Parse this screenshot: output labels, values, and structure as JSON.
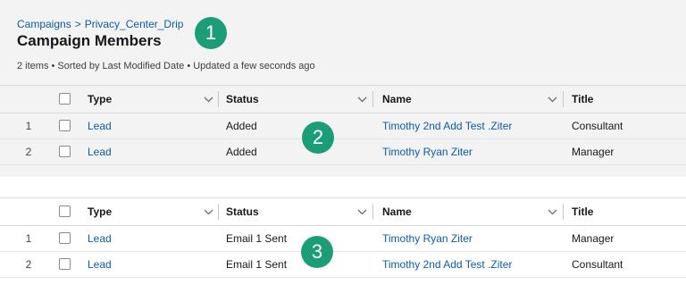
{
  "breadcrumb": {
    "parent": "Campaigns",
    "separator": ">",
    "current": "Privacy_Center_Drip"
  },
  "page_title": "Campaign Members",
  "summary": "2 items • Sorted by Last Modified Date • Updated a few seconds ago",
  "columns": {
    "type": "Type",
    "status": "Status",
    "name": "Name",
    "title": "Title"
  },
  "table1": {
    "rows": [
      {
        "num": "1",
        "type": "Lead",
        "status": "Added",
        "name": "Timothy 2nd Add Test .Ziter",
        "title": "Consultant"
      },
      {
        "num": "2",
        "type": "Lead",
        "status": "Added",
        "name": "Timothy Ryan Ziter",
        "title": "Manager"
      }
    ]
  },
  "table2": {
    "rows": [
      {
        "num": "1",
        "type": "Lead",
        "status": "Email 1 Sent",
        "name": "Timothy Ryan Ziter",
        "title": "Manager"
      },
      {
        "num": "2",
        "type": "Lead",
        "status": "Email 1 Sent",
        "name": "Timothy 2nd Add Test .Ziter",
        "title": "Consultant"
      }
    ]
  },
  "callouts": [
    "1",
    "2",
    "3"
  ],
  "colors": {
    "link": "#0b5cab",
    "badge": "#1b9e77",
    "panel_bg": "#f3f3f3"
  }
}
